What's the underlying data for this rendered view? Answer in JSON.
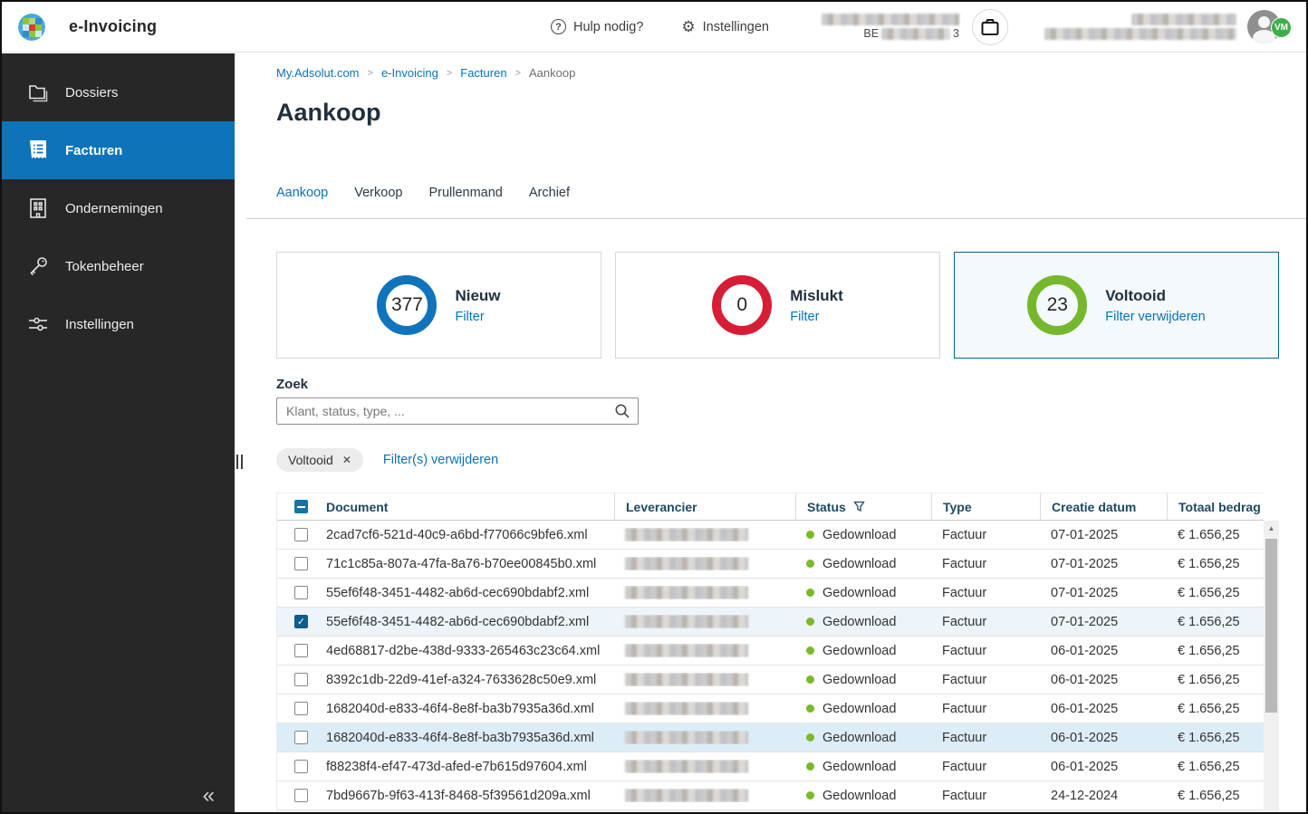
{
  "header": {
    "app_title": "e-Invoicing",
    "help_label": "Hulp nodig?",
    "help_glyph": "?",
    "settings_label": "Instellingen",
    "settings_glyph": "⚙",
    "company_vat_prefix": "BE",
    "company_vat_suffix": "3",
    "avatar_badge": "VM"
  },
  "sidebar": {
    "items": [
      {
        "label": "Dossiers"
      },
      {
        "label": "Facturen",
        "active": true
      },
      {
        "label": "Ondernemingen"
      },
      {
        "label": "Tokenbeheer"
      },
      {
        "label": "Instellingen"
      }
    ],
    "collapse_glyph": "«"
  },
  "breadcrumb": {
    "separator": ">",
    "items": [
      "My.Adsolut.com",
      "e-Invoicing",
      "Facturen",
      "Aankoop"
    ]
  },
  "page": {
    "title": "Aankoop"
  },
  "tabs": [
    {
      "label": "Aankoop",
      "active": true
    },
    {
      "label": "Verkoop"
    },
    {
      "label": "Prullenmand"
    },
    {
      "label": "Archief"
    }
  ],
  "cards": [
    {
      "count": "377",
      "label": "Nieuw",
      "action": "Filter",
      "ring_color": "#1074bc",
      "selected": false
    },
    {
      "count": "0",
      "label": "Mislukt",
      "action": "Filter",
      "ring_color": "#d51e35",
      "selected": false
    },
    {
      "count": "23",
      "label": "Voltooid",
      "action": "Filter verwijderen",
      "ring_color": "#76b82d",
      "selected": true
    }
  ],
  "search": {
    "label": "Zoek",
    "placeholder": "Klant, status, type, ..."
  },
  "filters": {
    "chip_label": "Voltooid",
    "chip_close_glyph": "✕",
    "clear_link": "Filter(s) verwijderen"
  },
  "table": {
    "columns": [
      "Document",
      "Leverancier",
      "Status",
      "Type",
      "Creatie datum",
      "Totaal bedrag"
    ],
    "check_glyph": "✓",
    "scroll_up_glyph": "▲",
    "rows": [
      {
        "document": "2cad7cf6-521d-40c9-a6bd-f77066c9bfe6.xml",
        "status": "Gedownload",
        "type": "Factuur",
        "date": "07-01-2025",
        "amount": "€ 1.656,25",
        "checked": false,
        "highlighted": false
      },
      {
        "document": "71c1c85a-807a-47fa-8a76-b70ee00845b0.xml",
        "status": "Gedownload",
        "type": "Factuur",
        "date": "07-01-2025",
        "amount": "€ 1.656,25",
        "checked": false,
        "highlighted": false
      },
      {
        "document": "55ef6f48-3451-4482-ab6d-cec690bdabf2.xml",
        "status": "Gedownload",
        "type": "Factuur",
        "date": "07-01-2025",
        "amount": "€ 1.656,25",
        "checked": false,
        "highlighted": false
      },
      {
        "document": "55ef6f48-3451-4482-ab6d-cec690bdabf2.xml",
        "status": "Gedownload",
        "type": "Factuur",
        "date": "07-01-2025",
        "amount": "€ 1.656,25",
        "checked": true,
        "highlighted": false
      },
      {
        "document": "4ed68817-d2be-438d-9333-265463c23c64.xml",
        "status": "Gedownload",
        "type": "Factuur",
        "date": "06-01-2025",
        "amount": "€ 1.656,25",
        "checked": false,
        "highlighted": false
      },
      {
        "document": "8392c1db-22d9-41ef-a324-7633628c50e9.xml",
        "status": "Gedownload",
        "type": "Factuur",
        "date": "06-01-2025",
        "amount": "€ 1.656,25",
        "checked": false,
        "highlighted": false
      },
      {
        "document": "1682040d-e833-46f4-8e8f-ba3b7935a36d.xml",
        "status": "Gedownload",
        "type": "Factuur",
        "date": "06-01-2025",
        "amount": "€ 1.656,25",
        "checked": false,
        "highlighted": false
      },
      {
        "document": "1682040d-e833-46f4-8e8f-ba3b7935a36d.xml",
        "status": "Gedownload",
        "type": "Factuur",
        "date": "06-01-2025",
        "amount": "€ 1.656,25",
        "checked": false,
        "highlighted": true
      },
      {
        "document": "f88238f4-ef47-473d-afed-e7b615d97604.xml",
        "status": "Gedownload",
        "type": "Factuur",
        "date": "06-01-2025",
        "amount": "€ 1.656,25",
        "checked": false,
        "highlighted": false
      },
      {
        "document": "7bd9667b-9f63-413f-8468-5f39561d209a.xml",
        "status": "Gedownload",
        "type": "Factuur",
        "date": "24-12-2024",
        "amount": "€ 1.656,25",
        "checked": false,
        "highlighted": false
      }
    ]
  },
  "colors": {
    "accent_blue": "#0a72b8",
    "sidebar_active": "#0d74ba",
    "status_green": "#7ab928",
    "ring_blue": "#1074bc",
    "ring_red": "#d51e35",
    "ring_green": "#76b82d",
    "selected_card_border": "#0a5f93"
  }
}
